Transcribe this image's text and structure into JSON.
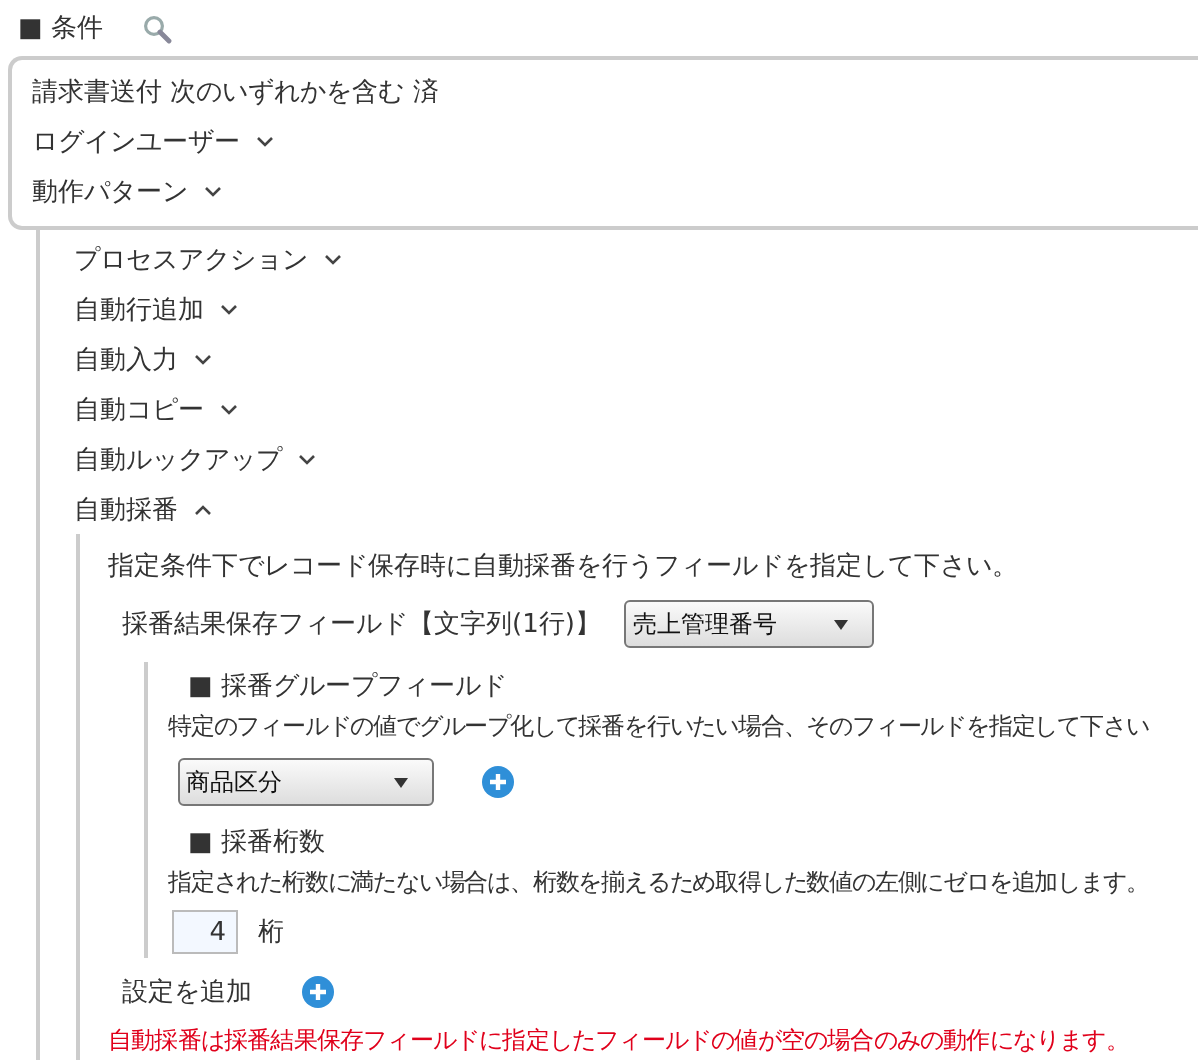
{
  "section": {
    "title": "■ 条件"
  },
  "condition_box": {
    "rows": [
      {
        "kind": "text",
        "label": "請求書送付 次のいずれかを含む 済"
      },
      {
        "kind": "dropdown",
        "label": "ログインユーザー",
        "expanded": false
      },
      {
        "kind": "dropdown",
        "label": "動作パターン",
        "expanded": false
      }
    ]
  },
  "actions": [
    {
      "label": "プロセスアクション",
      "expanded": false
    },
    {
      "label": "自動行追加",
      "expanded": false
    },
    {
      "label": "自動入力",
      "expanded": false
    },
    {
      "label": "自動コピー",
      "expanded": false
    },
    {
      "label": "自動ルックアップ",
      "expanded": false
    },
    {
      "label": "自動採番",
      "expanded": true,
      "panel": {
        "description": "指定条件下でレコード保存時に自動採番を行うフィールドを指定して下さい。",
        "result_field": {
          "label": "採番結果保存フィールド【文字列(1行)】",
          "value": "売上管理番号"
        },
        "group_field": {
          "heading": "■ 採番グループフィールド",
          "description": "特定のフィールドの値でグループ化して採番を行いたい場合、そのフィールドを指定して下さい",
          "value": "商品区分"
        },
        "digits": {
          "heading": "■ 採番桁数",
          "description": "指定された桁数に満たない場合は、桁数を揃えるため取得した数値の左側にゼロを追加します。",
          "value": "4",
          "unit": "桁"
        },
        "add_setting": "設定を追加",
        "note": "自動採番は採番結果保存フィールドに指定したフィールドの値が空の場合のみの動作になります。"
      }
    }
  ]
}
